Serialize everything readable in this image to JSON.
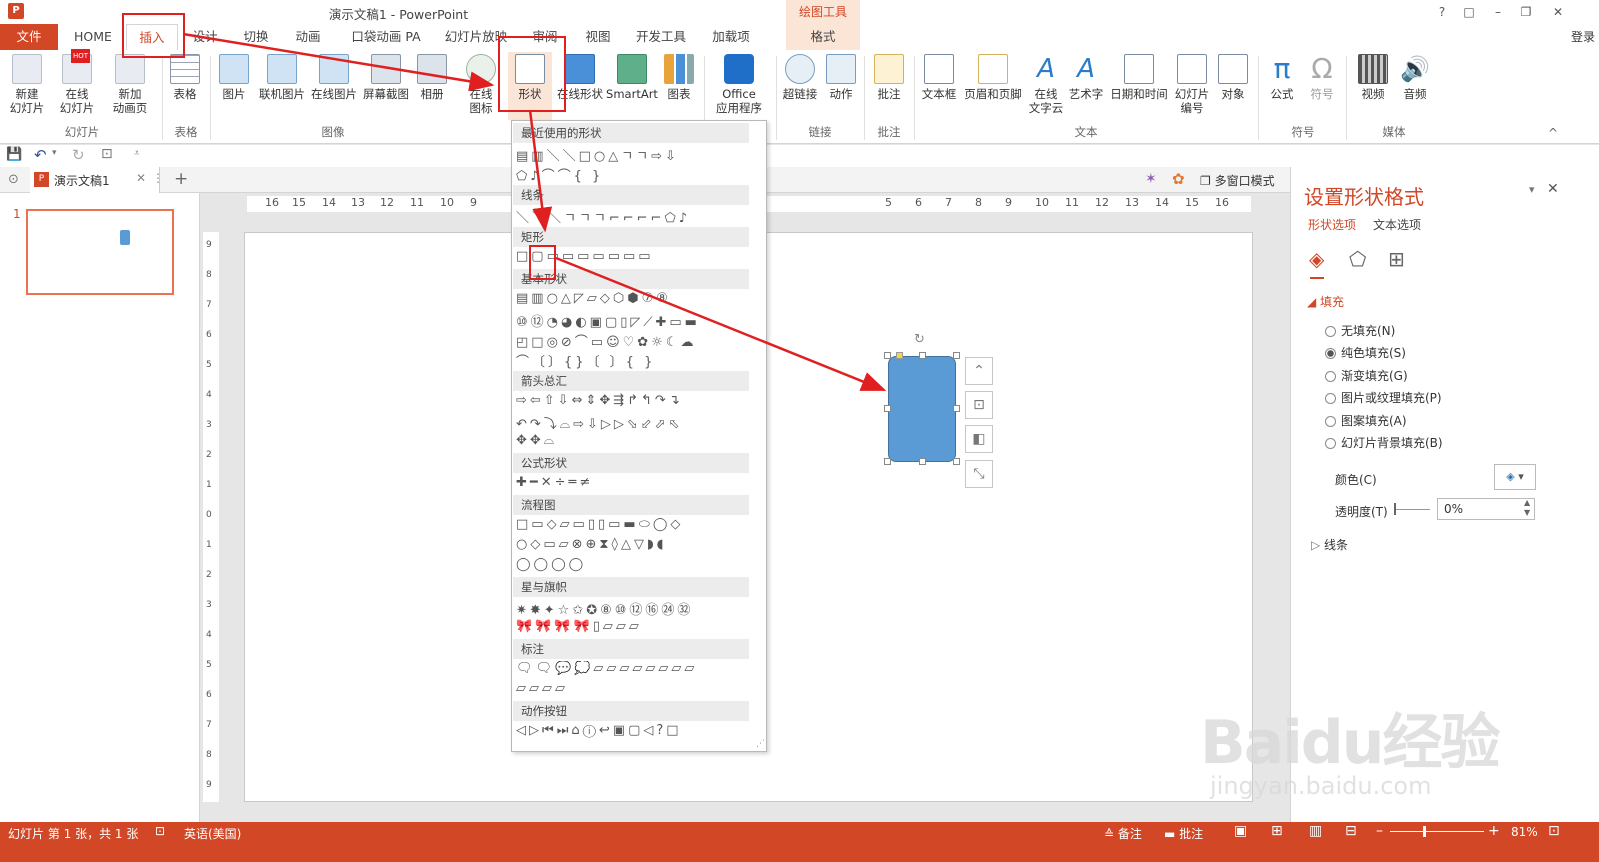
{
  "window": {
    "title": "演示文稿1 - PowerPoint",
    "app_icon": "P",
    "context_group": "绘图工具",
    "controls": [
      "?",
      "□",
      "–",
      "❐",
      "✕"
    ],
    "login": "登录"
  },
  "tabs": [
    "文件",
    "HOME",
    "插入",
    "设计",
    "切换",
    "动画",
    "口袋动画 PA",
    "幻灯片放映",
    "审阅",
    "视图",
    "开发工具",
    "加载项",
    "格式"
  ],
  "ribbon": {
    "buttons": [
      "新建\n幻灯片",
      "在线\n幻灯片",
      "新加\n动画页",
      "表格",
      "图片",
      "联机图片",
      "在线图片",
      "屏幕截图",
      "相册",
      "在线\n图标",
      "形状",
      "在线形状",
      "SmartArt",
      "图表",
      "Office\n应用程序",
      "超链接",
      "动作",
      "批注",
      "文本框",
      "页眉和页脚",
      "在线\n文字云",
      "艺术字",
      "日期和时间",
      "幻灯片\n编号",
      "对象",
      "公式",
      "符号",
      "视频",
      "音频"
    ],
    "hot_badge": "HOT",
    "groups": [
      "幻灯片",
      "表格",
      "图像",
      "链接",
      "批注",
      "文本",
      "符号",
      "媒体"
    ]
  },
  "doc_tab": {
    "name": "演示文稿1",
    "mode": "多窗口模式"
  },
  "thumbnail": {
    "number": "1"
  },
  "ruler": {
    "h_ticks": [
      "16",
      "15",
      "14",
      "13",
      "12",
      "11",
      "10",
      "9",
      "5",
      "6",
      "7",
      "8",
      "9",
      "10",
      "11",
      "12",
      "13",
      "14",
      "15",
      "16"
    ],
    "v_ticks": [
      "9",
      "8",
      "7",
      "6",
      "5",
      "4",
      "3",
      "2",
      "1",
      "0",
      "1",
      "2",
      "3",
      "4",
      "5",
      "6",
      "7",
      "8",
      "9"
    ]
  },
  "gallery": {
    "sections": [
      "最近使用的形状",
      "线条",
      "矩形",
      "基本形状",
      "箭头总汇",
      "公式形状",
      "流程图",
      "星与旗帜",
      "标注",
      "动作按钮"
    ],
    "rows": [
      "▤▥＼＼□○△ㄱㄱ⇨⇩",
      "⬠♪⌒⌒{ }",
      "＼＼＼ㄱㄱㄱ⌐⌐⌐⌐⬠♪",
      "□▢▭▭▭▭▭▭▭",
      "▤▥○△◸▱◇⬡⬢⑦⑧",
      "⑩⑫◔◕◐▣▢▯◸⟋✚▭▬",
      "◰□◎⊘⌒▭☺♡✿☼☾☁",
      "⌒〔〕{}〔 〕{ }",
      "⇨⇦⇧⇩⇔⇕✥⇶↱↰↷↴",
      "↶↷⤵⌓⇨⇩▷▷⬂⬃⬀⬁",
      "✥✥⌓",
      "✚━✕÷═≠",
      "□▭◇▱▭▯▯▭▬⬭◯◇",
      "○◇▭▱⊗⊕⧗◊△▽◗◖",
      "◯◯◯◯",
      "✷✸✦☆✩✪⑧⑩⑫⑯㉔㉜",
      "🎀🎀🎀🎀▯▱▱▱",
      "🗨🗨💬💭▱▱▱▱▱▱▱▱",
      "▱▱▱▱",
      "◁▷⏮⏭⌂ⓘ↩▣▢◁?□"
    ]
  },
  "format_pane": {
    "title": "设置形状格式",
    "tab_shape": "形状选项",
    "tab_text": "文本选项",
    "fill_header": "填充",
    "fill_options": [
      "无填充(N)",
      "纯色填充(S)",
      "渐变填充(G)",
      "图片或纹理填充(P)",
      "图案填充(A)",
      "幻灯片背景填充(B)"
    ],
    "selected_fill": "纯色填充(S)",
    "color_label": "颜色(C)",
    "transparency_label": "透明度(T)",
    "transparency_value": "0%",
    "line_header": "线条"
  },
  "statusbar": {
    "slide_info": "幻灯片 第 1 张，共 1 张",
    "language": "英语(美国)",
    "notes": "备注",
    "comments": "批注",
    "zoom": "81%"
  },
  "watermark": {
    "main": "Baidu经验",
    "sub": "jingyan.baidu.com"
  },
  "colors": {
    "accent": "#d24726",
    "shape_fill": "#5b9bd5",
    "annotation": "#e02020"
  }
}
